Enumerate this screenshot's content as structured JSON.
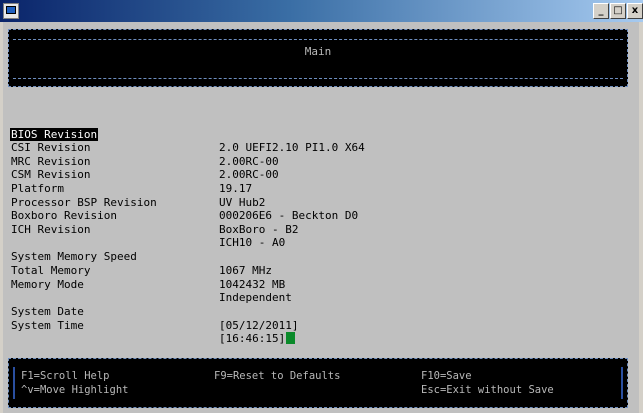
{
  "window": {
    "minimize_glyph": "_",
    "maximize_glyph": "□",
    "close_glyph": "x"
  },
  "header": {
    "title": "Main"
  },
  "info_rows": [
    {
      "label": "BIOS Revision",
      "value": "2.0 UEFI2.10 PI1.0 X64"
    },
    {
      "label": "CSI Revision",
      "value": "2.00RC-00"
    },
    {
      "label": "MRC Revision",
      "value": "2.00RC-00"
    },
    {
      "label": "CSM Revision",
      "value": "19.17"
    },
    {
      "label": "Platform",
      "value": "UV Hub2"
    },
    {
      "label": "Processor BSP Revision",
      "value": "000206E6 - Beckton D0"
    },
    {
      "label": "Boxboro Revision",
      "value": "BoxBoro - B2"
    },
    {
      "label": "ICH Revision",
      "value": "ICH10 - A0"
    }
  ],
  "memory_rows": [
    {
      "label": "System Memory Speed",
      "value": "1067 MHz"
    },
    {
      "label": "Total Memory",
      "value": "1042432 MB"
    },
    {
      "label": "Memory Mode",
      "value": "Independent"
    }
  ],
  "system_date": {
    "label": "System Date",
    "value": "[05/12/2011]"
  },
  "system_time": {
    "label": "System Time",
    "value": "[16:46:15]"
  },
  "footer": {
    "f1": "F1=Scroll Help",
    "move": "^v=Move Highlight",
    "f9": "F9=Reset to Defaults",
    "f10": "F10=Save",
    "esc": "Esc=Exit without Save"
  },
  "colors": {
    "screen_bg": "#c0c0c0",
    "box_bg": "#000000",
    "cursor": "#0a8a2a"
  }
}
